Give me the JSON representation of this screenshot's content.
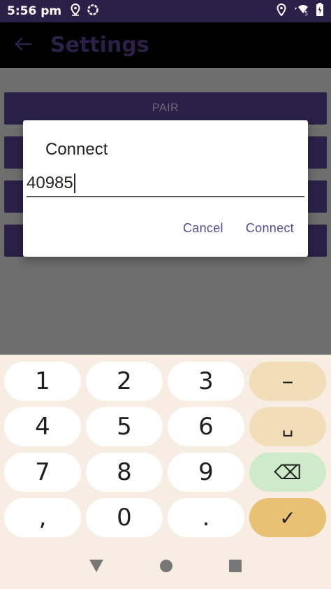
{
  "status_bar": {
    "time": "5:56 pm",
    "left_icons": [
      "location-icon",
      "sync-ring-icon"
    ],
    "right_icons": [
      "location-icon",
      "wifi-icon",
      "battery-icon"
    ],
    "wifi_badge": "5"
  },
  "app_bar": {
    "back_icon": "back-arrow-icon",
    "title": "Settings"
  },
  "content": {
    "buttons": [
      {
        "label": "PAIR"
      },
      {
        "label": ""
      },
      {
        "label": ""
      },
      {
        "label": ""
      }
    ]
  },
  "dialog": {
    "title": "Connect",
    "input_value": "40985",
    "cancel_label": "Cancel",
    "connect_label": "Connect"
  },
  "keyboard": {
    "keys": [
      "1",
      "2",
      "3",
      "–",
      "4",
      "5",
      "6",
      "␣",
      "7",
      "8",
      "9",
      "⌫",
      ",",
      "0",
      ".",
      "✓"
    ]
  },
  "nav_bar": {
    "icons": [
      "back-triangle-icon",
      "home-circle-icon",
      "recents-square-icon"
    ]
  },
  "colors": {
    "primary": "#2b2148",
    "dialog_accent": "#5b4a94",
    "keyboard_bg": "#f7ede2",
    "enter_key": "#e8c172"
  }
}
